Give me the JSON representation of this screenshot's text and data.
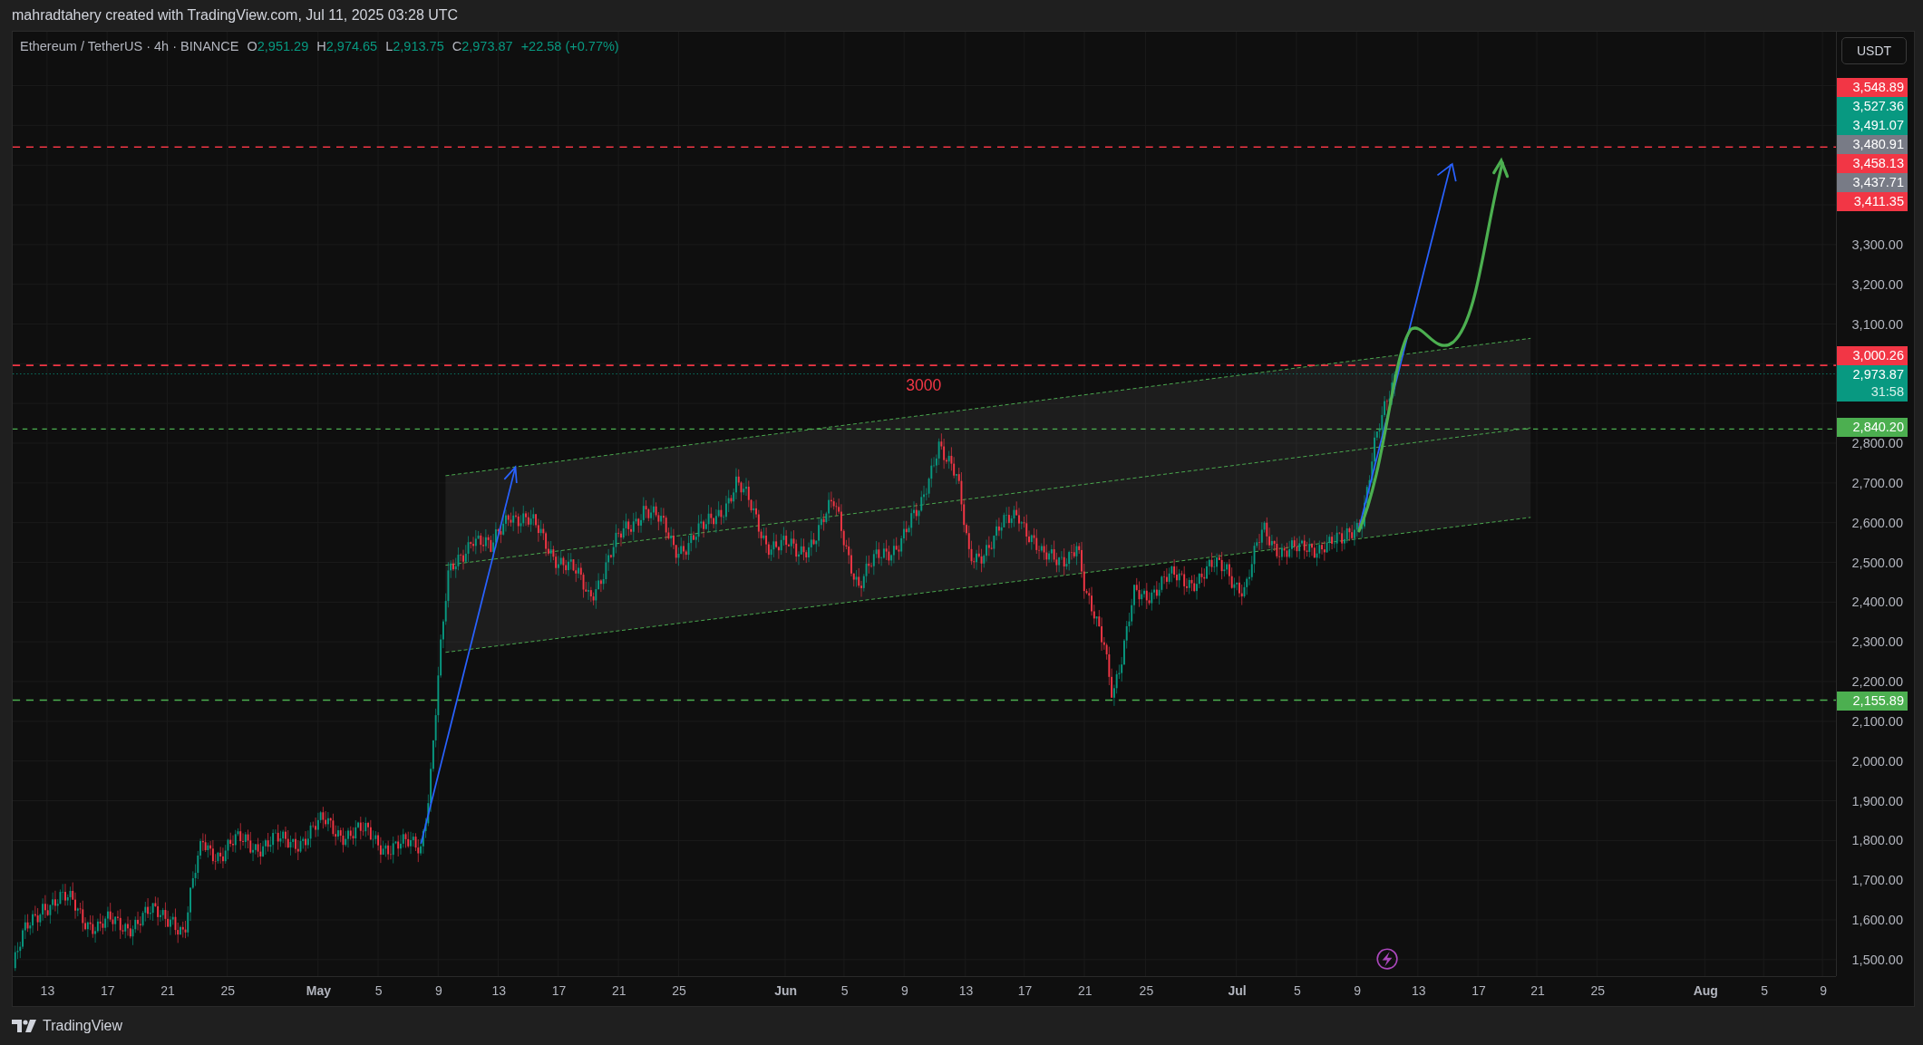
{
  "attribution": "mahradtahery created with TradingView.com, Jul 11, 2025 03:28 UTC",
  "legend": {
    "symbol": "Ethereum / TetherUS · 4h · BINANCE",
    "ohlc": [
      {
        "label": "O",
        "value": "2,951.29"
      },
      {
        "label": "H",
        "value": "2,974.65"
      },
      {
        "label": "L",
        "value": "2,913.75"
      },
      {
        "label": "C",
        "value": "2,973.87"
      }
    ],
    "change": "+22.58 (+0.77%)"
  },
  "chart": {
    "annotation": "3000"
  },
  "price_axis": {
    "currency": "USDT",
    "ticks": [
      "3,300.00",
      "3,200.00",
      "3,100.00",
      "2,800.00",
      "2,700.00",
      "2,600.00",
      "2,500.00",
      "2,400.00",
      "2,300.00",
      "2,200.00",
      "2,100.00",
      "2,000.00",
      "1,900.00",
      "1,800.00",
      "1,700.00",
      "1,600.00",
      "1,500.00"
    ],
    "tags": [
      {
        "text": "3,548.89",
        "color": "#f23645"
      },
      {
        "text": "3,527.36",
        "color": "#089981"
      },
      {
        "text": "3,491.07",
        "color": "#089981"
      },
      {
        "text": "3,480.91",
        "color": "#787b86"
      },
      {
        "text": "3,458.13",
        "color": "#f23645"
      },
      {
        "text": "3,437.71",
        "color": "#787b86"
      },
      {
        "text": "3,411.35",
        "color": "#f23645"
      },
      {
        "text": "3,000.26",
        "color": "#f23645"
      },
      {
        "text": "2,973.87",
        "color": "#089981",
        "countdown": "31:58"
      },
      {
        "text": "2,840.20",
        "color": "#4caf50"
      },
      {
        "text": "2,155.89",
        "color": "#4caf50"
      }
    ]
  },
  "time_axis": [
    {
      "text": "13",
      "kind": "day"
    },
    {
      "text": "17",
      "kind": "day"
    },
    {
      "text": "21",
      "kind": "day"
    },
    {
      "text": "25",
      "kind": "day"
    },
    {
      "text": "May",
      "kind": "month"
    },
    {
      "text": "5",
      "kind": "day"
    },
    {
      "text": "9",
      "kind": "day"
    },
    {
      "text": "13",
      "kind": "day"
    },
    {
      "text": "17",
      "kind": "day"
    },
    {
      "text": "21",
      "kind": "day"
    },
    {
      "text": "25",
      "kind": "day"
    },
    {
      "text": "Jun",
      "kind": "month"
    },
    {
      "text": "5",
      "kind": "day"
    },
    {
      "text": "9",
      "kind": "day"
    },
    {
      "text": "13",
      "kind": "day"
    },
    {
      "text": "17",
      "kind": "day"
    },
    {
      "text": "21",
      "kind": "day"
    },
    {
      "text": "25",
      "kind": "day"
    },
    {
      "text": "Jul",
      "kind": "month"
    },
    {
      "text": "5",
      "kind": "day"
    },
    {
      "text": "9",
      "kind": "day"
    },
    {
      "text": "13",
      "kind": "day"
    },
    {
      "text": "17",
      "kind": "day"
    },
    {
      "text": "21",
      "kind": "day"
    },
    {
      "text": "25",
      "kind": "day"
    },
    {
      "text": "Aug",
      "kind": "month"
    },
    {
      "text": "5",
      "kind": "day"
    },
    {
      "text": "9",
      "kind": "day"
    }
  ],
  "footer": {
    "brand": "TradingView"
  }
}
